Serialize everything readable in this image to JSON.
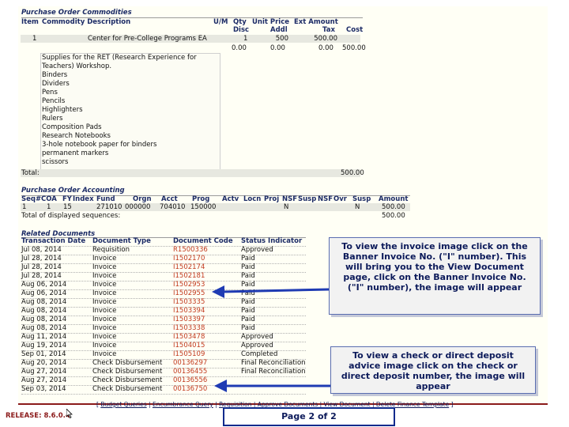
{
  "commodities": {
    "section_title": "Purchase Order Commodities",
    "head1": [
      "Item",
      "Commodity Description",
      "U/M",
      "Qty",
      "Unit Price",
      "Ext Amount",
      ""
    ],
    "head2": [
      "",
      "",
      "",
      "Disc",
      "Addl",
      "Tax",
      "Cost"
    ],
    "item_no": "1",
    "item_desc": "Center for Pre-College Programs EA",
    "item_qty": "1",
    "item_price": "500",
    "item_ext": "500.00",
    "item_disc": "0.00",
    "item_addl": "0.00",
    "item_tax": "0.00",
    "item_cost": "500.00",
    "text_lines": [
      "Supplies for the RET (Research Experience for",
      "Teachers) Workshop.",
      "Binders",
      "Dividers",
      "Pens",
      "Pencils",
      "Highlighters",
      "Rulers",
      "Composition Pads",
      "Research Notebooks",
      "3-hole notebook paper for binders",
      "permanent markers",
      "scissors"
    ],
    "total_label": "Total:",
    "total_value": "500.00"
  },
  "accounting": {
    "section_title": "Purchase Order Accounting",
    "headers": [
      "Seq#",
      "COA",
      "FY",
      "Index",
      "Fund",
      "Orgn",
      "Acct",
      "Prog",
      "Actv",
      "Locn",
      "Proj",
      "NSF",
      "Susp",
      "NSF",
      "Ovr",
      "Susp",
      "Amount"
    ],
    "row": [
      "1",
      "1",
      "15",
      "",
      "271010",
      "000000",
      "704010",
      "150000",
      "",
      "",
      "",
      "N",
      "",
      "",
      "",
      "N",
      "500.00"
    ],
    "total_label": "Total of displayed sequences:",
    "total_value": "500.00"
  },
  "related": {
    "section_title": "Related Documents",
    "headers": [
      "Transaction Date",
      "Document Type",
      "Document Code",
      "Status Indicator"
    ],
    "rows": [
      [
        "Jul 08, 2014",
        "Requisition",
        "R1500336",
        "Approved"
      ],
      [
        "Jul 28, 2014",
        "Invoice",
        "I1502170",
        "Paid"
      ],
      [
        "Jul 28, 2014",
        "Invoice",
        "I1502174",
        "Paid"
      ],
      [
        "Jul 28, 2014",
        "Invoice",
        "I1502181",
        "Paid"
      ],
      [
        "Aug 06, 2014",
        "Invoice",
        "I1502953",
        "Paid"
      ],
      [
        "Aug 06, 2014",
        "Invoice",
        "I1502955",
        "Paid"
      ],
      [
        "Aug 08, 2014",
        "Invoice",
        "I1503335",
        "Paid"
      ],
      [
        "Aug 08, 2014",
        "Invoice",
        "I1503394",
        "Paid"
      ],
      [
        "Aug 08, 2014",
        "Invoice",
        "I1503397",
        "Paid"
      ],
      [
        "Aug 08, 2014",
        "Invoice",
        "I1503338",
        "Paid"
      ],
      [
        "Aug 11, 2014",
        "Invoice",
        "I1503478",
        "Approved"
      ],
      [
        "Aug 19, 2014",
        "Invoice",
        "I1504015",
        "Approved"
      ],
      [
        "Sep 01, 2014",
        "Invoice",
        "I1505109",
        "Completed"
      ],
      [
        "Aug 20, 2014",
        "Check Disbursement",
        "00136297",
        "Final Reconciliation"
      ],
      [
        "Aug 27, 2014",
        "Check Disbursement",
        "00136455",
        "Final Reconciliation"
      ],
      [
        "Aug 27, 2014",
        "Check Disbursement",
        "00136556",
        ""
      ],
      [
        "Sep 03, 2014",
        "Check Disbursement",
        "00136750",
        ""
      ]
    ]
  },
  "callouts": {
    "invoice": "To view the invoice image click on the Banner Invoice No. (\"I\" number). This will bring you to the View Document page, click on the Banner Invoice No. (\"I\" number), the image will appear",
    "check": "To view a check or direct deposit advice image click on the check or direct deposit number, the image will appear"
  },
  "footer": {
    "links": [
      "Budget Queries",
      "Encumbrance Query",
      "Requisition",
      "Approve Documents",
      "View Document",
      "Delete Finance Template"
    ],
    "release": "RELEASE: 8.6.0.4",
    "page": "Page 2 of 2"
  },
  "colors": {
    "header_text": "#1c2b66",
    "link": "#c23a1f",
    "arrow": "#1f3bb3",
    "footer_bar": "#8b1a1a"
  }
}
